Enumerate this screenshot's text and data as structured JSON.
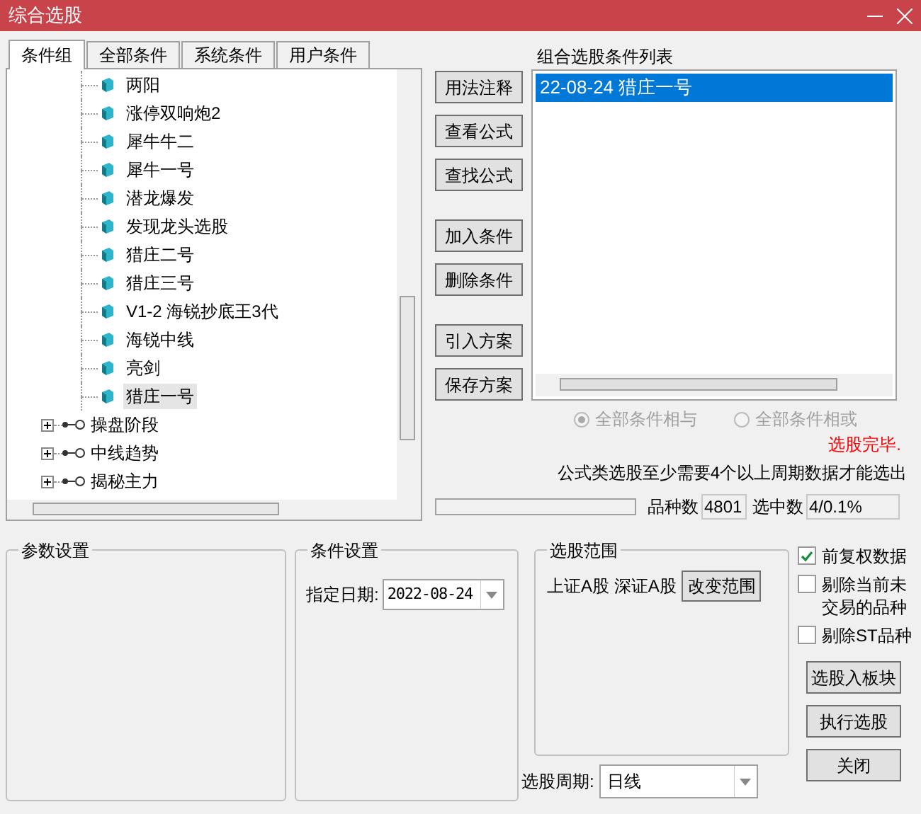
{
  "window": {
    "title": "综合选股"
  },
  "tabs": [
    {
      "label": "条件组",
      "selected": true
    },
    {
      "label": "全部条件",
      "selected": false
    },
    {
      "label": "系统条件",
      "selected": false
    },
    {
      "label": "用户条件",
      "selected": false
    }
  ],
  "tree": [
    {
      "children": [
        {
          "label": "两阳",
          "selected": false
        },
        {
          "label": "涨停双响炮2",
          "selected": false
        },
        {
          "label": "犀牛牛二",
          "selected": false
        },
        {
          "label": "犀牛一号",
          "selected": false
        },
        {
          "label": "潜龙爆发",
          "selected": false
        },
        {
          "label": "发现龙头选股",
          "selected": false
        },
        {
          "label": "猎庄二号",
          "selected": false
        },
        {
          "label": "猎庄三号",
          "selected": false
        },
        {
          "label": "V1-2 海锐抄底王3代",
          "selected": false
        },
        {
          "label": "海锐中线",
          "selected": false
        },
        {
          "label": "亮剑",
          "selected": false
        },
        {
          "label": "猎庄一号",
          "selected": true
        }
      ]
    },
    {
      "label": "操盘阶段",
      "expanded": false
    },
    {
      "label": "中线趋势",
      "expanded": false
    },
    {
      "label": "揭秘主力",
      "expanded": false
    }
  ],
  "action_buttons": [
    [
      "用法注释",
      "查看公式",
      "查找公式"
    ],
    [
      "加入条件",
      "删除条件"
    ],
    [
      "引入方案",
      "保存方案"
    ]
  ],
  "condition_list": {
    "title": "组合选股条件列表",
    "items": [
      {
        "label": "22-08-24 猎庄一号",
        "selected": true
      }
    ]
  },
  "logic_options": [
    {
      "label": "全部条件相与",
      "selected": true
    },
    {
      "label": "全部条件相或",
      "selected": false
    }
  ],
  "status": "选股完毕.",
  "notice": "公式类选股至少需要4个以上周期数据才能选出",
  "progress": {
    "level": 0
  },
  "stock_count": {
    "label": "品种数",
    "value": "4801"
  },
  "selected_count": {
    "label": "选中数",
    "value": "4/0.1%"
  },
  "param_group": {
    "title": "参数设置"
  },
  "condition_group": {
    "title": "条件设置",
    "date_label": "指定日期:",
    "date_value": "2022-08-24"
  },
  "range_group": {
    "title": "选股范围",
    "markets": "上证A股 深证A股",
    "button": "改变范围"
  },
  "period": {
    "label": "选股周期:",
    "value": "日线"
  },
  "options": [
    {
      "label": "前复权数据",
      "checked": true
    },
    {
      "label": "剔除当前未交易的品种",
      "checked": false
    },
    {
      "label": "剔除ST品种",
      "checked": false
    }
  ],
  "bottom_buttons": [
    "选股入板块",
    "执行选股",
    "关闭"
  ]
}
